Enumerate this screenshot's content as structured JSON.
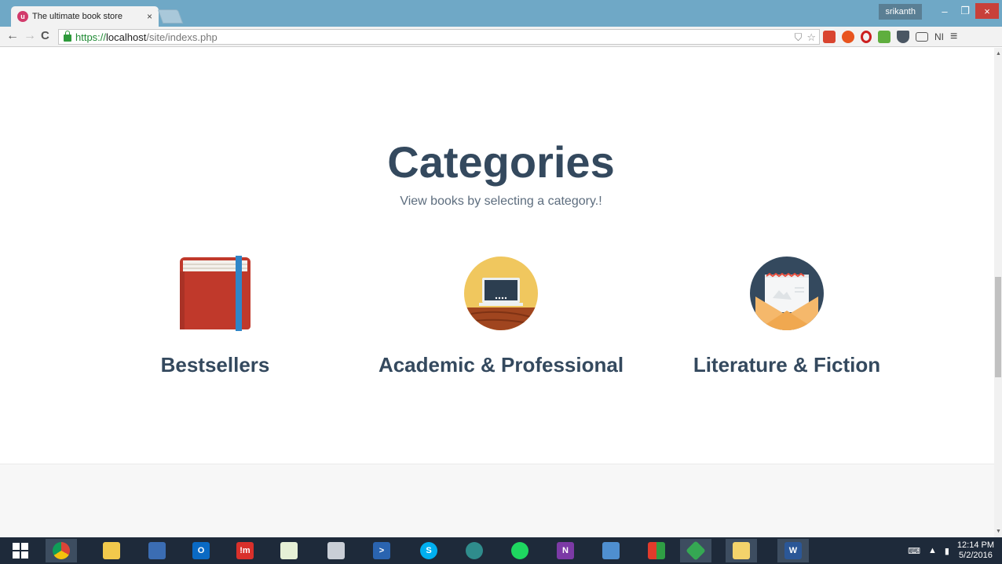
{
  "browser": {
    "tab_title": "The ultimate book store",
    "tab_close": "×",
    "user": "srikanth",
    "url_scheme": "https://",
    "url_host": "localhost",
    "url_path": "/site/indexs.php",
    "window_buttons": {
      "minimize": "–",
      "maximize": "❐",
      "close": "×"
    },
    "nav": {
      "back": "←",
      "forward": "→",
      "reload": "C"
    },
    "menu_glyph": "≡"
  },
  "page": {
    "title": "Categories",
    "subtitle": "View books by selecting a category.!",
    "categories": [
      {
        "label": "Bestsellers",
        "icon": "book-icon",
        "colors": {
          "cover": "#c0392b",
          "ribbon": "#2f86c8"
        }
      },
      {
        "label": "Academic & Professional",
        "icon": "chalkboard-icon",
        "colors": {
          "circle": "#f0c75e",
          "desk": "#a0451f",
          "board": "#2c3e50"
        }
      },
      {
        "label": "Literature & Fiction",
        "icon": "envelope-icon",
        "colors": {
          "circle": "#34495e",
          "envelope": "#f5b86b"
        }
      }
    ]
  },
  "taskbar": {
    "time": "12:14 PM",
    "date": "5/2/2016",
    "apps": [
      "start-icon",
      "chrome-icon",
      "file-explorer-icon",
      "network-icon",
      "outlook-icon",
      "im-icon",
      "project-icon",
      "calculator-icon",
      "powershell-icon",
      "skype-icon",
      "browser-icon",
      "spotify-icon",
      "onenote-icon",
      "remote-desktop-icon",
      "tiles-icon",
      "app-green-icon",
      "app-folder-icon",
      "word-icon"
    ]
  },
  "colors": {
    "heading": "#34495e",
    "titlebar": "#6fa8c6",
    "taskbar": "#1e2a3a"
  }
}
